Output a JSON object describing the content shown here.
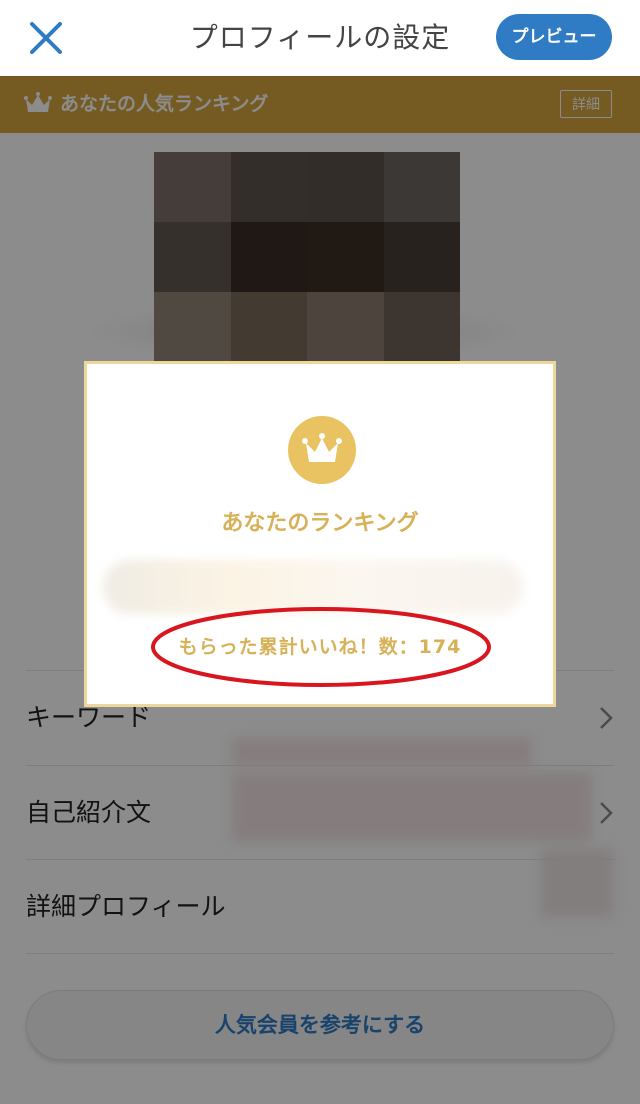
{
  "header": {
    "title": "プロフィールの設定",
    "preview_label": "プレビュー",
    "close_icon": "close-icon"
  },
  "banner": {
    "text": "あなたの人気ランキング",
    "detail_label": "詳細",
    "icon": "crown-icon",
    "color": "#d5a63e"
  },
  "list": {
    "items": [
      {
        "label": "キーワード"
      },
      {
        "label": "自己紹介文"
      },
      {
        "label": "詳細プロフィール"
      }
    ],
    "reference_button_label": "人気会員を参考にする"
  },
  "modal": {
    "title": "あなたのランキング",
    "likes_label": "もらった累計いいね！数：",
    "likes_count": "174",
    "icon": "crown-icon",
    "accent_color": "#d7b157",
    "highlight_color": "#d9161f"
  },
  "colors": {
    "primary": "#2f7bc4",
    "gold": "#d5a63e"
  }
}
